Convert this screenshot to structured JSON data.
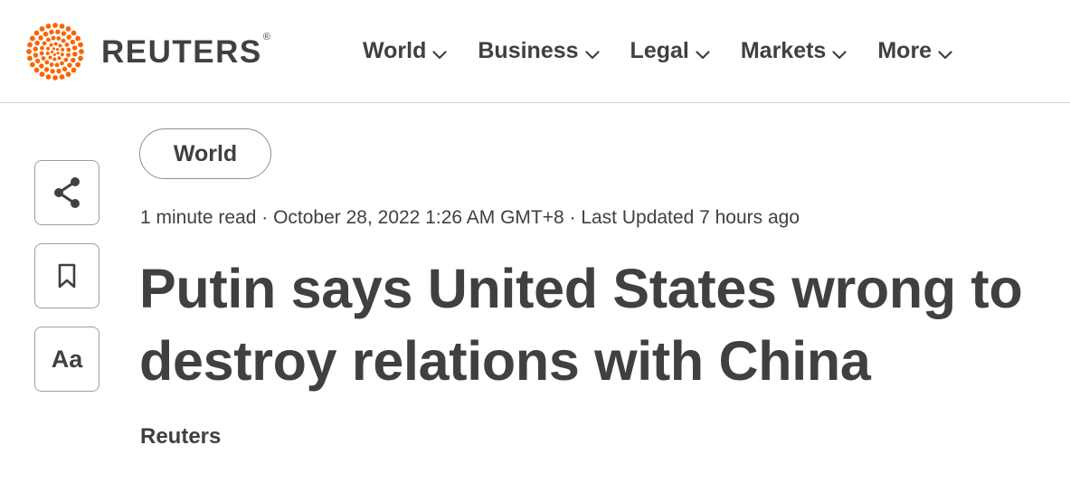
{
  "header": {
    "logo": {
      "wordmark": "REUTERS",
      "registered_mark": "®",
      "brand_color": "#fa6400"
    },
    "nav": [
      {
        "label": "World",
        "icon": "chevron-down-icon"
      },
      {
        "label": "Business",
        "icon": "chevron-down-icon"
      },
      {
        "label": "Legal",
        "icon": "chevron-down-icon"
      },
      {
        "label": "Markets",
        "icon": "chevron-down-icon"
      },
      {
        "label": "More",
        "icon": "chevron-down-icon"
      }
    ]
  },
  "toolbar": {
    "share_icon": "share-icon",
    "bookmark_icon": "bookmark-icon",
    "text_size_label": "Aa"
  },
  "article": {
    "section": "World",
    "meta": "1 minute read · October 28, 2022 1:26 AM GMT+8 · Last Updated 7 hours ago",
    "headline": "Putin says United States wrong to destroy relations with China",
    "byline": "Reuters"
  },
  "colors": {
    "text": "#404040",
    "accent": "#fa6400",
    "border": "#d6d6d6"
  }
}
